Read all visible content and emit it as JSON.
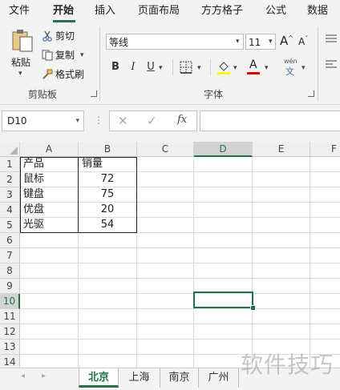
{
  "ribbon": {
    "tabs": [
      "文件",
      "开始",
      "插入",
      "页面布局",
      "方方格子",
      "公式",
      "数据"
    ],
    "active_tab": "开始",
    "clipboard": {
      "paste_label": "粘贴",
      "cut_label": "剪切",
      "copy_label": "复制",
      "format_painter_label": "格式刷",
      "group_label": "剪贴板"
    },
    "font": {
      "font_name": "等线",
      "font_size": "11",
      "bold_label": "B",
      "italic_label": "I",
      "underline_label": "U",
      "grow_label": "A",
      "shrink_label": "A",
      "font_color_label": "A",
      "phonetic_label": "wén",
      "phonetic_sub": "文",
      "group_label": "字体",
      "fill_color": "#ffff00",
      "font_color": "#e00000"
    }
  },
  "formula_bar": {
    "name_box": "D10",
    "cancel_icon": "✕",
    "enter_icon": "✓",
    "fx_label": "fx",
    "formula": ""
  },
  "sheet": {
    "columns": [
      "A",
      "B",
      "C",
      "D",
      "E",
      "F"
    ],
    "rows": [
      "1",
      "2",
      "3",
      "4",
      "5",
      "6",
      "7",
      "8",
      "9",
      "10",
      "11",
      "12",
      "13",
      "14"
    ],
    "selected_cell": "D10",
    "cells": [
      [
        "产品",
        "销量"
      ],
      [
        "鼠标",
        "72"
      ],
      [
        "键盘",
        "75"
      ],
      [
        "优盘",
        "20"
      ],
      [
        "光驱",
        "54"
      ]
    ]
  },
  "sheet_tabs": {
    "tabs": [
      "北京",
      "上海",
      "南京",
      "广州"
    ],
    "active": "北京"
  },
  "watermark": "软件技巧",
  "colors": {
    "accent": "#217346"
  }
}
